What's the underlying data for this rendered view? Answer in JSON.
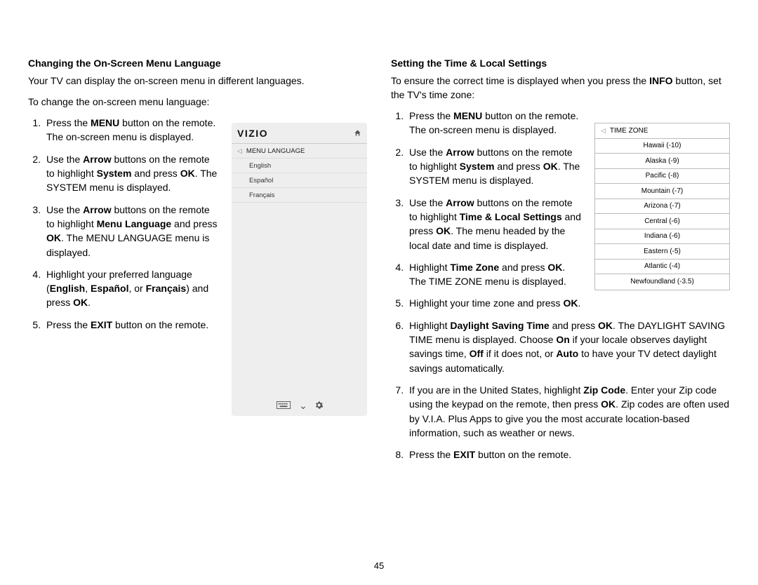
{
  "page_number": "45",
  "left": {
    "heading": "Changing the On-Screen Menu Language",
    "intro1": "Your TV can display the on-screen menu in different languages.",
    "intro2": "To change the on-screen menu language:",
    "steps": [
      "Press the <b>MENU</b> button on the remote. The on-screen menu is displayed.",
      "Use the <b>Arrow</b> buttons on the remote to highlight <b>System</b> and press <b>OK</b>. The SYSTEM menu is displayed.",
      "Use the <b>Arrow</b> buttons on the remote to highlight <b>Menu Language</b> and press <b>OK</b>. The MENU LANGUAGE menu is displayed.",
      "Highlight your preferred language (<b>English</b>, <b>Español</b>, or <b>Français</b>) and press <b>OK</b>.",
      "Press the <b>EXIT</b> button on the remote."
    ],
    "menu": {
      "logo": "VIZIO",
      "title": "MENU LANGUAGE",
      "options": [
        "English",
        "Español",
        "Français"
      ]
    }
  },
  "right": {
    "heading": "Setting the Time & Local Settings",
    "intro1": "To ensure the correct time is displayed when you press the <b>INFO</b> button, set the TV's time zone:",
    "steps": [
      "Press the <b>MENU</b> button on the remote. The on-screen menu is displayed.",
      "Use the <b>Arrow</b> buttons on the remote to highlight <b>System</b> and press <b>OK</b>. The SYSTEM menu is displayed.",
      "Use the <b>Arrow</b> buttons on the remote to highlight <b>Time & Local Settings</b> and press <b>OK</b>. The menu headed by the local date and time is displayed.",
      "Highlight <b>Time Zone</b> and press <b>OK</b>. The TIME ZONE menu is displayed.",
      "Highlight your time zone and press <b>OK</b>.",
      "Highlight <b>Daylight Saving Time</b> and press <b>OK</b>. The DAYLIGHT SAVING TIME menu is displayed. Choose <b>On</b> if your locale observes daylight savings time, <b>Off</b> if it does not, or <b>Auto</b> to have your TV detect daylight savings automatically.",
      "If you are in the United States, highlight <b>Zip Code</b>. Enter your Zip code using the keypad on the remote, then press <b>OK</b>. Zip codes are often used by V.I.A. Plus Apps to give you the most accurate location-based information, such as weather or news.",
      "Press the <b>EXIT</b> button on the remote."
    ],
    "tz_header": "TIME ZONE",
    "tz_rows": [
      "Hawaii (-10)",
      "Alaska (-9)",
      "Pacific (-8)",
      "Mountain (-7)",
      "Arizona (-7)",
      "Central (-6)",
      "Indiana (-6)",
      "Eastern (-5)",
      "Atlantic (-4)",
      "Newfoundland (-3.5)"
    ]
  }
}
